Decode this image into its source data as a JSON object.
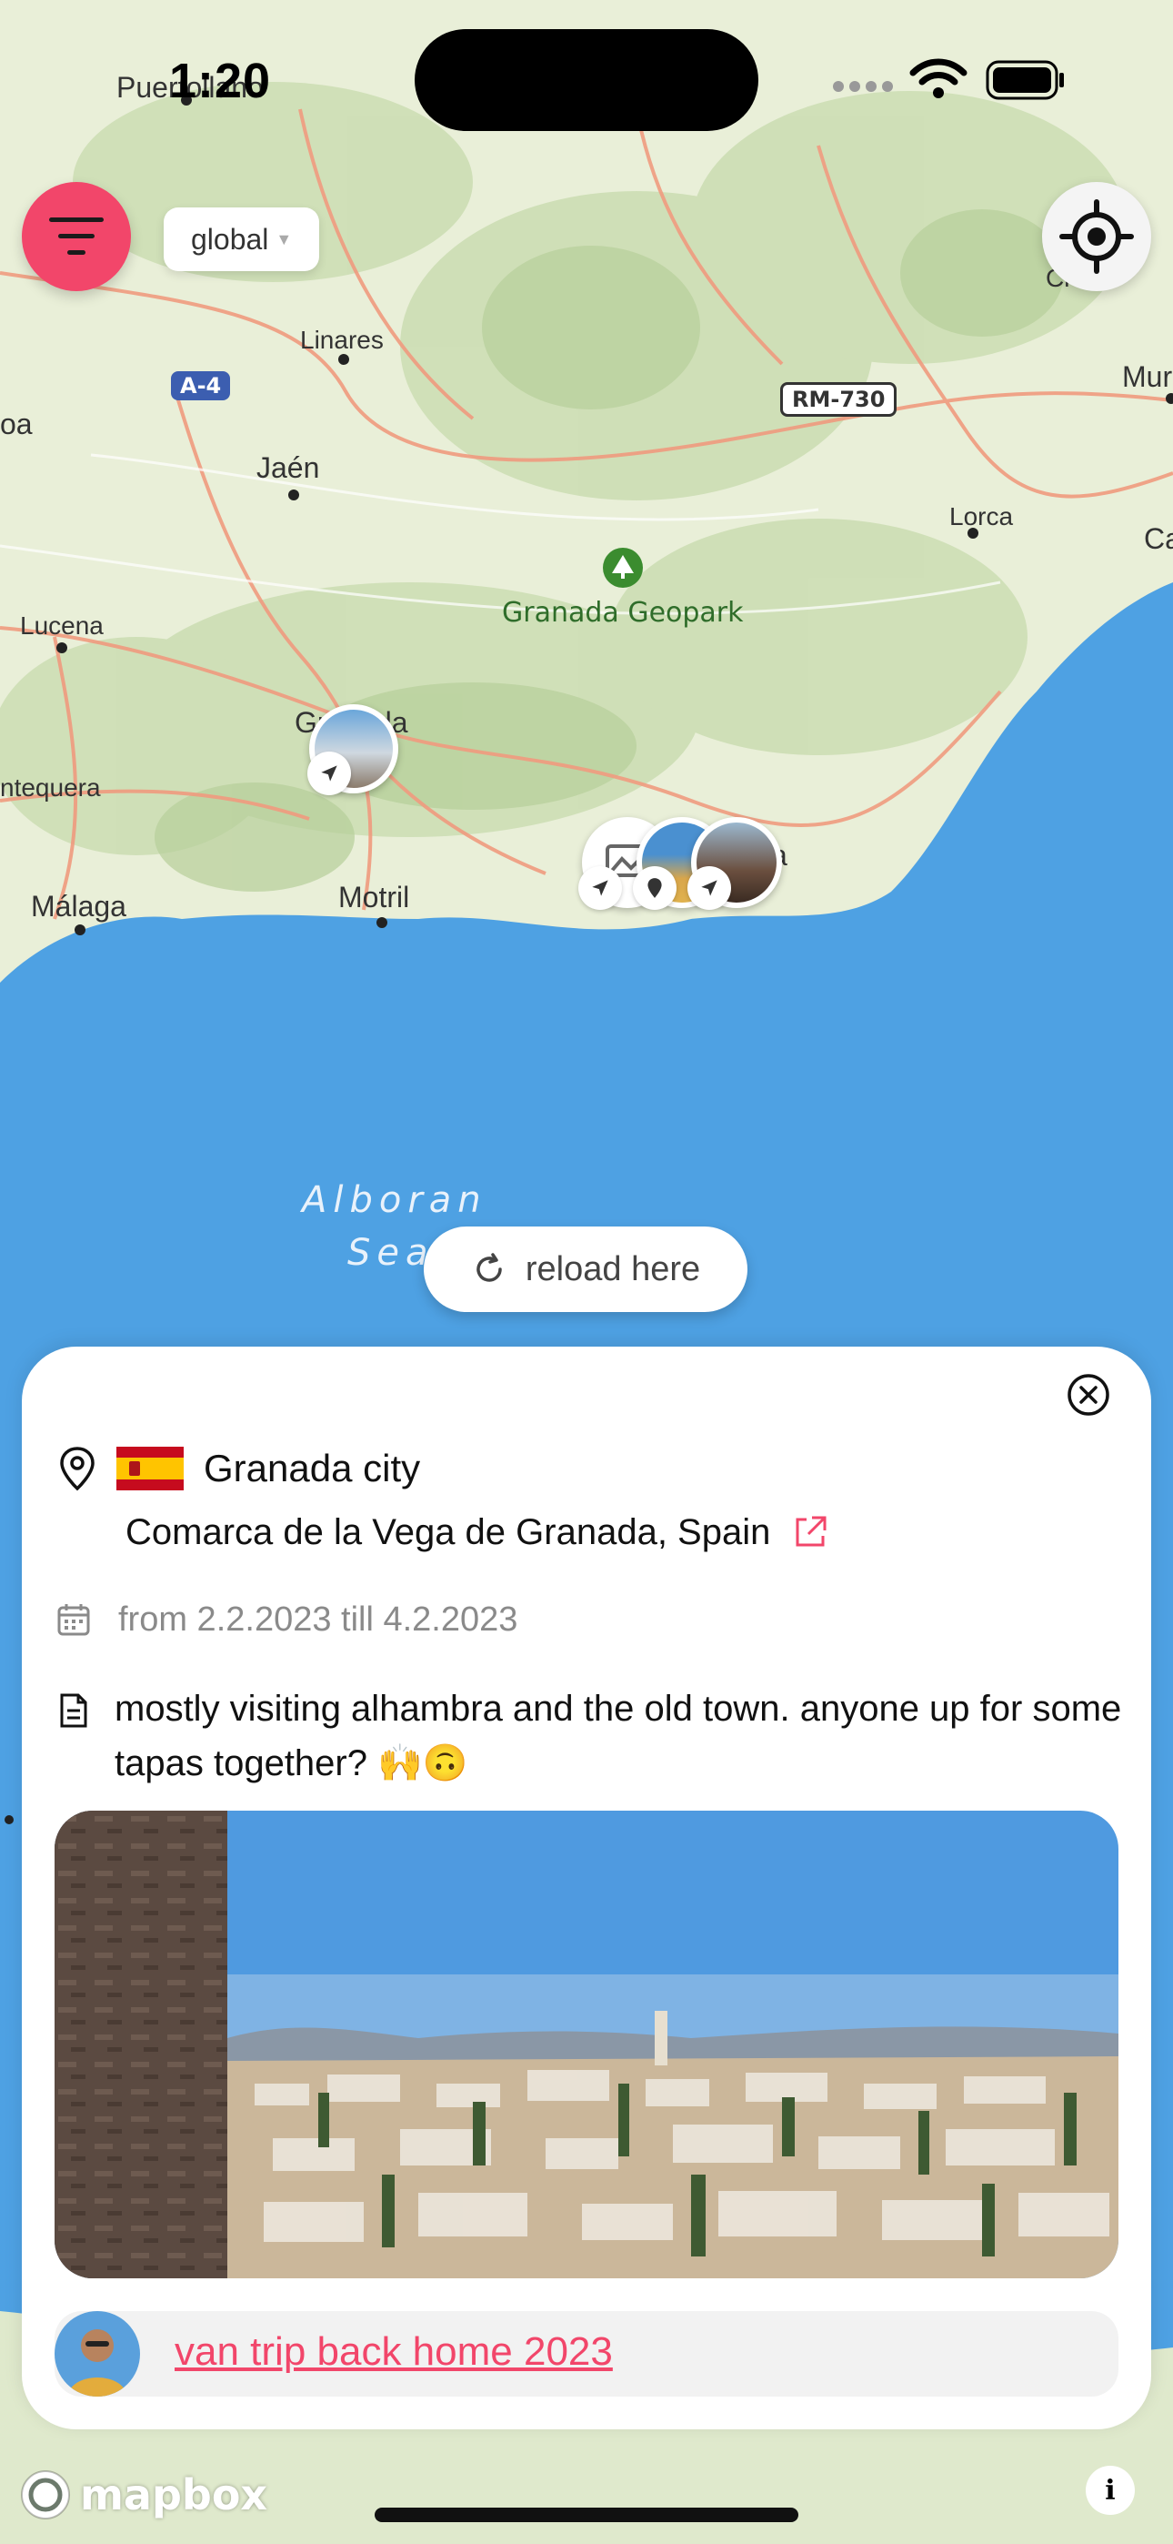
{
  "status_bar": {
    "time": "1:20"
  },
  "controls": {
    "scope_value": "global"
  },
  "map": {
    "labels": {
      "puertollano": "Puertollano",
      "linares": "Linares",
      "jaen": "Jaén",
      "lucena": "Lucena",
      "antequera": "ntequera",
      "malaga": "Málaga",
      "granada": "Granada",
      "motril": "Motril",
      "lorca": "Lorca",
      "granada_geopark": "Granada Geopark",
      "sea_line1": "Alboran",
      "sea_line2": "Sea",
      "edge_left_1": "oa",
      "edge_right_1": "Mur",
      "edge_right_2": "Ca",
      "edge_right_3": "Ci",
      "almeria_end": "a"
    },
    "roads": {
      "a4": "A-4",
      "rm730": "RM-730"
    },
    "colors": {
      "land": "#e9efd8",
      "sea": "#4ea1e3",
      "accent": "#f2466a"
    }
  },
  "reload": {
    "label": "reload here"
  },
  "detail": {
    "place": "Granada city",
    "country_flag": "Spain flag",
    "region": "Comarca de la Vega de Granada, Spain",
    "dates": "from 2.2.2023  till 4.2.2023",
    "description": "mostly visiting alhambra and the old town. anyone up for some tapas together? 🙌🙃",
    "trip_name": "van trip back home 2023"
  },
  "footer": {
    "mapbox": "mapbox",
    "info": "i"
  }
}
